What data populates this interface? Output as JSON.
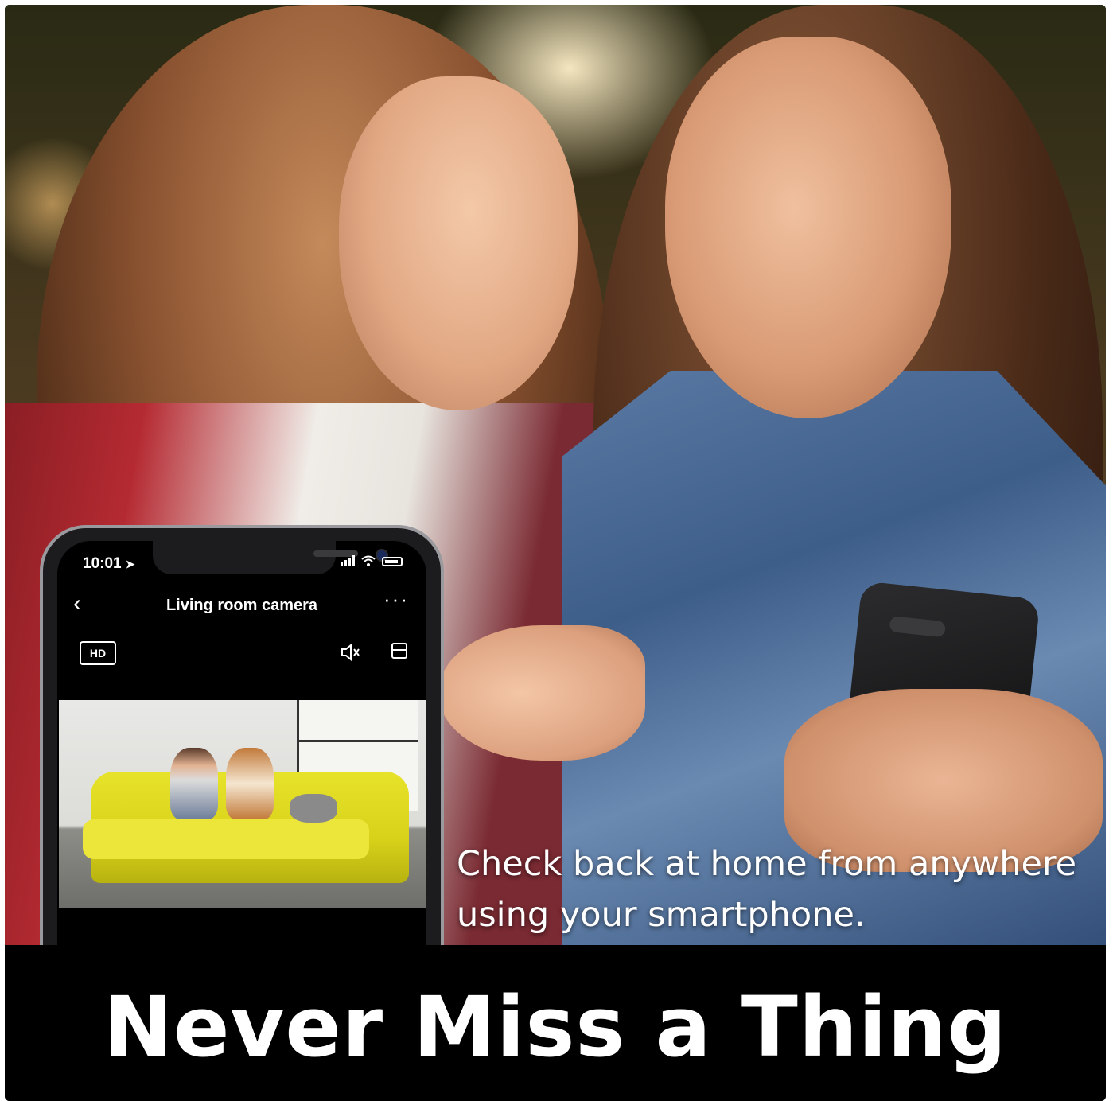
{
  "phone_app": {
    "status_time": "10:01",
    "title": "Living room camera",
    "back_glyph": "‹",
    "more_glyph": "···",
    "hd_label": "HD",
    "icons": [
      "back-chevron-icon",
      "more-options-icon",
      "hd-quality-icon",
      "speaker-muted-icon",
      "layout-toggle-icon",
      "signal-icon",
      "wifi-icon",
      "battery-icon",
      "location-arrow-icon"
    ]
  },
  "caption": {
    "line1": "Check back at home from anywhere",
    "line2": "using your smartphone."
  },
  "banner": {
    "headline": "Never Miss a Thing"
  },
  "colors": {
    "banner_bg": "#000000",
    "sofa_yellow": "#e7e22a",
    "text": "#ffffff"
  }
}
